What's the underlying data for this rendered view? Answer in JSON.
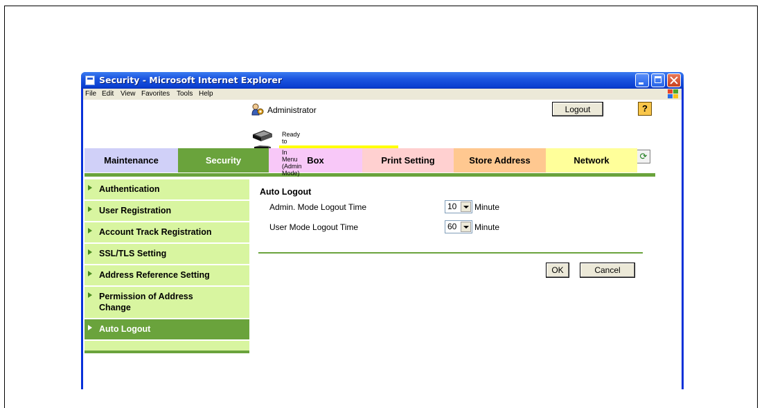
{
  "window": {
    "title": "Security - Microsoft Internet Explorer"
  },
  "menubar": {
    "items": [
      "File",
      "Edit",
      "View",
      "Favorites",
      "Tools",
      "Help"
    ]
  },
  "header": {
    "user": "Administrator",
    "logout_label": "Logout",
    "help_label": "?"
  },
  "status": {
    "scan": "Ready to Scan",
    "mode": "In Menu (Admin Mode)"
  },
  "tabs": [
    {
      "label": "Maintenance",
      "color": "#d0d0f8"
    },
    {
      "label": "Security",
      "color": "#6aa33c",
      "active": true
    },
    {
      "label": "Box",
      "color": "#f8c8f8"
    },
    {
      "label": "Print Setting",
      "color": "#ffd0d0"
    },
    {
      "label": "Store Address",
      "color": "#ffc890"
    },
    {
      "label": "Network",
      "color": "#ffff9a"
    }
  ],
  "sidebar": {
    "items": [
      {
        "label": "Authentication"
      },
      {
        "label": "User Registration"
      },
      {
        "label": "Account Track Registration"
      },
      {
        "label": "SSL/TLS Setting"
      },
      {
        "label": "Address Reference Setting"
      },
      {
        "label": "Permission of Address Change"
      },
      {
        "label": "Auto Logout",
        "active": true
      }
    ]
  },
  "main": {
    "title": "Auto Logout",
    "fields": [
      {
        "label": "Admin. Mode Logout Time",
        "value": "10",
        "unit": "Minute"
      },
      {
        "label": "User Mode Logout Time",
        "value": "60",
        "unit": "Minute"
      }
    ],
    "ok_label": "OK",
    "cancel_label": "Cancel"
  },
  "icons": {
    "title": "ie-page-icon",
    "admin": "administrator-icon",
    "scanner": "scanner-icon",
    "printer": "printer-icon",
    "refresh": "refresh-icon",
    "help": "help-icon",
    "windows": "windows-logo-icon"
  },
  "colors": {
    "accent": "#6aa33c",
    "sidebar_bg": "#d8f5a0",
    "highlight": "#ffff00"
  }
}
